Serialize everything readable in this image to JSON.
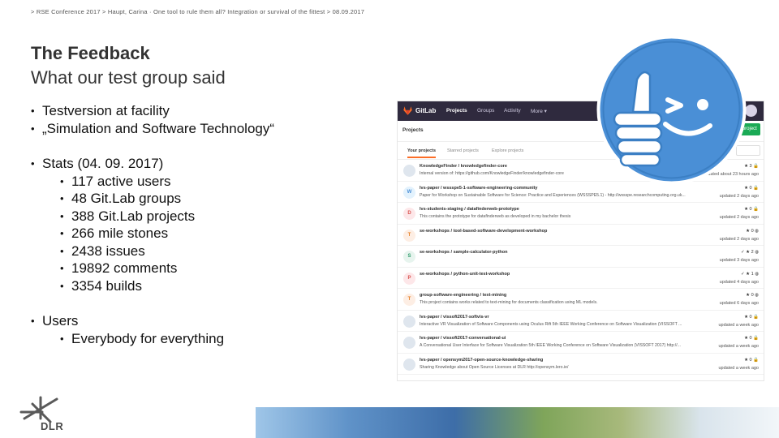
{
  "breadcrumb": "> RSE Conference 2017 > Haupt, Carina  ·  One tool to rule them all? Integration or survival of the fittest > 08.09.2017",
  "slide": {
    "title": "The Feedback",
    "subtitle": "What our test group said"
  },
  "bullets": {
    "testversion_line1": "Testversion at facility",
    "testversion_line2": "„Simulation and Software Technology“",
    "stats_heading": "Stats (04. 09. 2017)",
    "stats": [
      "117 active users",
      "48 Git.Lab groups",
      "388 Git.Lab projects",
      "266 mile stones",
      "2438 issues",
      "19892 comments",
      "3354 builds"
    ],
    "users_heading": "Users",
    "users_sub": "Everybody for everything"
  },
  "gitlab": {
    "brand": "GitLab",
    "nav": [
      "Projects",
      "Groups",
      "Activity",
      "More ▾"
    ],
    "header_title": "Projects",
    "new_project": "New project",
    "tabs": [
      "Your projects",
      "Starred projects",
      "Explore projects"
    ],
    "projects": [
      {
        "initial": "",
        "name": "KnowledgeFinder / knowledgefinder-core",
        "desc": "Internal version of: https://github.com/KnowledgeFinder/knowledgefinder-core",
        "stats": "★ 3  🔒",
        "updated": "updated about 23 hours ago"
      },
      {
        "initial": "W",
        "name": "lvs-paper / wssspe5-1-software-engineering-community",
        "desc": "Paper for Workshop on Sustainable Software for Science: Practice and Experiences (WSSSPE5.1) - http://wssspe.researchcomputing.org.uk...",
        "stats": "★ 0  🔒",
        "updated": "updated 2 days ago"
      },
      {
        "initial": "D",
        "name": "lvs-students-staging / datafinderweb-prototype",
        "desc": "This contains the prototype for datafinderweb as developed in my bachelor thesis",
        "stats": "★ 0  🔒",
        "updated": "updated 2 days ago"
      },
      {
        "initial": "T",
        "name": "se-workshops / tool-based-software-development-workshop",
        "desc": "",
        "stats": "★ 0  ◍",
        "updated": "updated 2 days ago"
      },
      {
        "initial": "S",
        "name": "se-workshops / sample-calculator-python",
        "desc": "",
        "stats": "✓  ★ 2  ◍",
        "updated": "updated 3 days ago"
      },
      {
        "initial": "P",
        "name": "se-workshops / python-unit-test-workshop",
        "desc": "",
        "stats": "✓  ★ 1  ◍",
        "updated": "updated 4 days ago"
      },
      {
        "initial": "T",
        "name": "group-software-engineering / text-mining",
        "desc": "This project contains works related to text-mining for documents classification using ML models.",
        "stats": "★ 0  ◍",
        "updated": "updated 6 days ago"
      },
      {
        "initial": "",
        "name": "lvs-paper / vissoft2017-softvis-vr",
        "desc": "Interactive VR Visualization of Software Components using Oculus Rift 5th IEEE Working Conference on Software Visualization (VISSOFT ...",
        "stats": "★ 0  🔒",
        "updated": "updated a week ago"
      },
      {
        "initial": "",
        "name": "lvs-paper / vissoft2017-conversational-ui",
        "desc": "A Conversational User Interface for Software Visualization 5th IEEE Working Conference on Software Visualization (VISSOFT 2017) http://...",
        "stats": "★ 0  🔒",
        "updated": "updated a week ago"
      },
      {
        "initial": "",
        "name": "lvs-paper / opensym2017-open-source-knowledge-sharing",
        "desc": "Sharing Knowledge about Open Source Licenses at DLR http://opensym.lero.ie/",
        "stats": "★ 0  🔒",
        "updated": "updated a week ago"
      }
    ]
  },
  "logo": {
    "text": "DLR"
  },
  "colors": {
    "gitlab_nav": "#2f2a3e",
    "gitlab_orange": "#fc6d26",
    "emoji_blue": "#4a8fd6"
  }
}
